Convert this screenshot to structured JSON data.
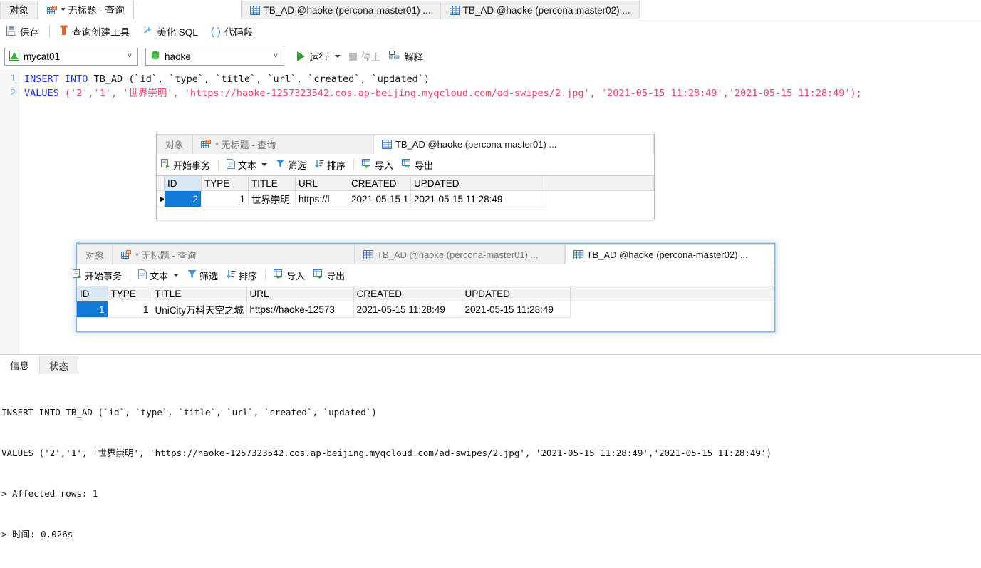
{
  "window_tabs": [
    {
      "label": "对象",
      "icon": "none",
      "state": "inactive"
    },
    {
      "label": "* 无标题 - 查询",
      "icon": "query-icon",
      "state": "active"
    },
    {
      "label": "TB_AD @haoke (percona-master01) ...",
      "icon": "grid-icon",
      "state": "inactive"
    },
    {
      "label": "TB_AD @haoke (percona-master02) ...",
      "icon": "grid-icon",
      "state": "inactive"
    }
  ],
  "toolbar": {
    "save": "保存",
    "query_builder": "查询创建工具",
    "beautify_sql": "美化 SQL",
    "code_snippet": "代码段"
  },
  "connection_bar": {
    "connection": "mycat01",
    "database": "haoke",
    "run": "运行",
    "stop": "停止",
    "explain": "解释"
  },
  "editor": {
    "line_numbers": [
      "1",
      "2"
    ],
    "line1": {
      "kw": "INSERT INTO ",
      "table": "TB_AD (`id`, `type`, `title`, `url`, `created`, `updated`)"
    },
    "line2": {
      "kw": "VALUES ",
      "open": "(",
      "v1": "'2'",
      "c1": ",",
      "v2": "'1'",
      "c2": ", ",
      "v3": "'世界崇明'",
      "c3": ", ",
      "v4": "'https://haoke-1257323542.cos.ap-beijing.myqcloud.com/ad-swipes/2.jpg'",
      "c4": ", ",
      "v5": "'2021-05-15 11:28:49'",
      "c5": ",",
      "v6": "'2021-05-15 11:28:49'",
      "close": ");"
    }
  },
  "result_window_1": {
    "tabs": [
      {
        "label": "对象",
        "icon": "none",
        "state": "inactive"
      },
      {
        "label": "* 无标题 - 查询",
        "icon": "query-icon",
        "state": "inactive"
      },
      {
        "label": "TB_AD @haoke (percona-master01) ...",
        "icon": "grid-icon",
        "state": "active"
      }
    ],
    "toolbar": {
      "begin_transaction": "开始事务",
      "text": "文本",
      "filter": "筛选",
      "sort": "排序",
      "import": "导入",
      "export": "导出"
    },
    "columns": [
      "ID",
      "TYPE",
      "TITLE",
      "URL",
      "CREATED",
      "UPDATED"
    ],
    "rows": [
      {
        "marker": "▶",
        "ID": "2",
        "TYPE": "1",
        "TITLE": "世界崇明",
        "URL": "https://l",
        "CREATED": "2021-05-15 1",
        "UPDATED": "2021-05-15 11:28:49"
      }
    ]
  },
  "result_window_2": {
    "tabs": [
      {
        "label": "对象",
        "icon": "none",
        "state": "inactive"
      },
      {
        "label": "* 无标题 - 查询",
        "icon": "query-icon",
        "state": "inactive"
      },
      {
        "label": "TB_AD @haoke (percona-master01) ...",
        "icon": "grid-icon",
        "state": "inactive"
      },
      {
        "label": "TB_AD @haoke (percona-master02) ...",
        "icon": "grid-icon",
        "state": "active"
      }
    ],
    "toolbar": {
      "begin_transaction": "开始事务",
      "text": "文本",
      "filter": "筛选",
      "sort": "排序",
      "import": "导入",
      "export": "导出"
    },
    "columns": [
      "ID",
      "TYPE",
      "TITLE",
      "URL",
      "CREATED",
      "UPDATED"
    ],
    "rows": [
      {
        "marker": "",
        "ID": "1",
        "TYPE": "1",
        "TITLE": "UniCity万科天空之城",
        "URL": "https://haoke-12573",
        "CREATED": "2021-05-15 11:28:49",
        "UPDATED": "2021-05-15 11:28:49"
      }
    ]
  },
  "output_panel": {
    "tabs": [
      {
        "label": "信息",
        "state": "active"
      },
      {
        "label": "状态",
        "state": "inactive"
      }
    ],
    "lines": [
      "INSERT INTO TB_AD (`id`, `type`, `title`, `url`, `created`, `updated`)",
      "VALUES ('2','1', '世界崇明', 'https://haoke-1257323542.cos.ap-beijing.myqcloud.com/ad-swipes/2.jpg', '2021-05-15 11:28:49','2021-05-15 11:28:49')",
      "> Affected rows: 1",
      "> 时间: 0.026s"
    ]
  },
  "colors": {
    "accent_blue": "#1379d6",
    "keyword_blue": "#1f35f5",
    "string_pink": "#f6416c",
    "run_green": "#35a135",
    "tab_inactive_bg": "#f0f0f0"
  }
}
